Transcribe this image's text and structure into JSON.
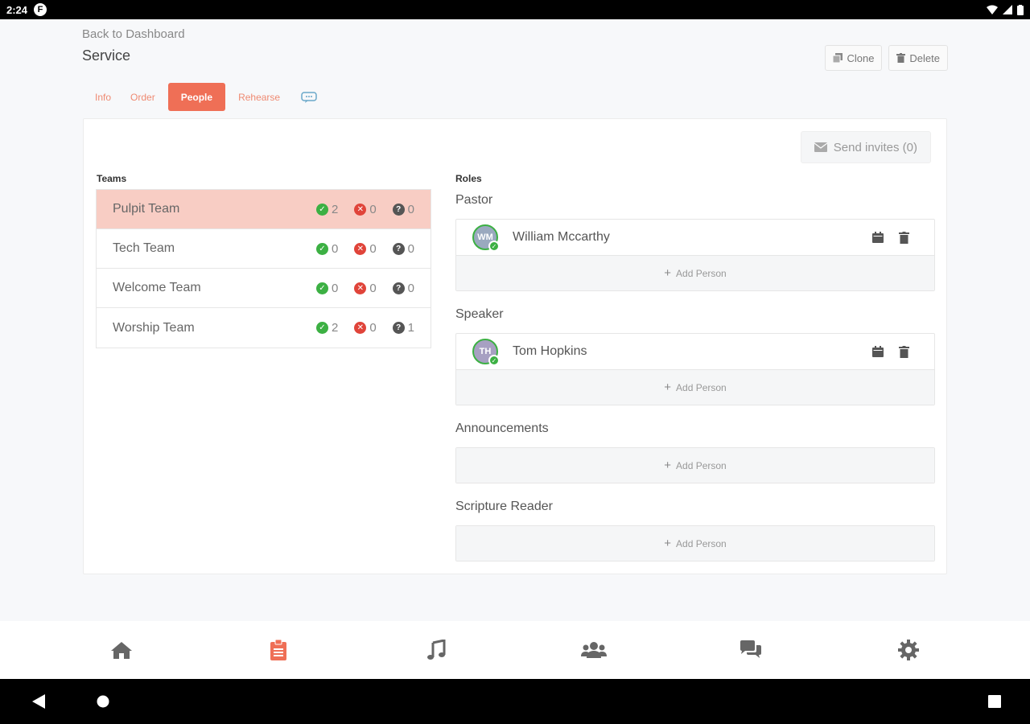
{
  "status_bar": {
    "time": "2:24",
    "app_badge": "F"
  },
  "header": {
    "back_label": "Back to Dashboard",
    "title": "Service"
  },
  "actions": {
    "clone_label": "Clone",
    "delete_label": "Delete"
  },
  "tabs": [
    {
      "label": "Info"
    },
    {
      "label": "Order"
    },
    {
      "label": "People",
      "active": true
    },
    {
      "label": "Rehearse"
    }
  ],
  "send_invites_label": "Send invites (0)",
  "teams_heading": "Teams",
  "roles_heading": "Roles",
  "teams": [
    {
      "name": "Pulpit Team",
      "accepted": "2",
      "declined": "0",
      "pending": "0",
      "selected": true
    },
    {
      "name": "Tech Team",
      "accepted": "0",
      "declined": "0",
      "pending": "0"
    },
    {
      "name": "Welcome Team",
      "accepted": "0",
      "declined": "0",
      "pending": "0"
    },
    {
      "name": "Worship Team",
      "accepted": "2",
      "declined": "0",
      "pending": "1"
    }
  ],
  "roles": [
    {
      "name": "Pastor",
      "people": [
        {
          "name": "William Mccarthy",
          "initials": "WM"
        }
      ]
    },
    {
      "name": "Speaker",
      "people": [
        {
          "name": "Tom Hopkins",
          "initials": "TH"
        }
      ]
    },
    {
      "name": "Announcements",
      "people": []
    },
    {
      "name": "Scripture Reader",
      "people": []
    }
  ],
  "add_person_label": "Add Person",
  "bottom_nav": [
    {
      "icon": "home-icon"
    },
    {
      "icon": "clipboard-icon",
      "active": true
    },
    {
      "icon": "music-icon"
    },
    {
      "icon": "users-icon"
    },
    {
      "icon": "chat-icon"
    },
    {
      "icon": "gear-icon"
    }
  ],
  "colors": {
    "accent": "#ef6f56",
    "selected_row": "#f8cdc4",
    "ok": "#3cb043",
    "no": "#e0443a"
  }
}
